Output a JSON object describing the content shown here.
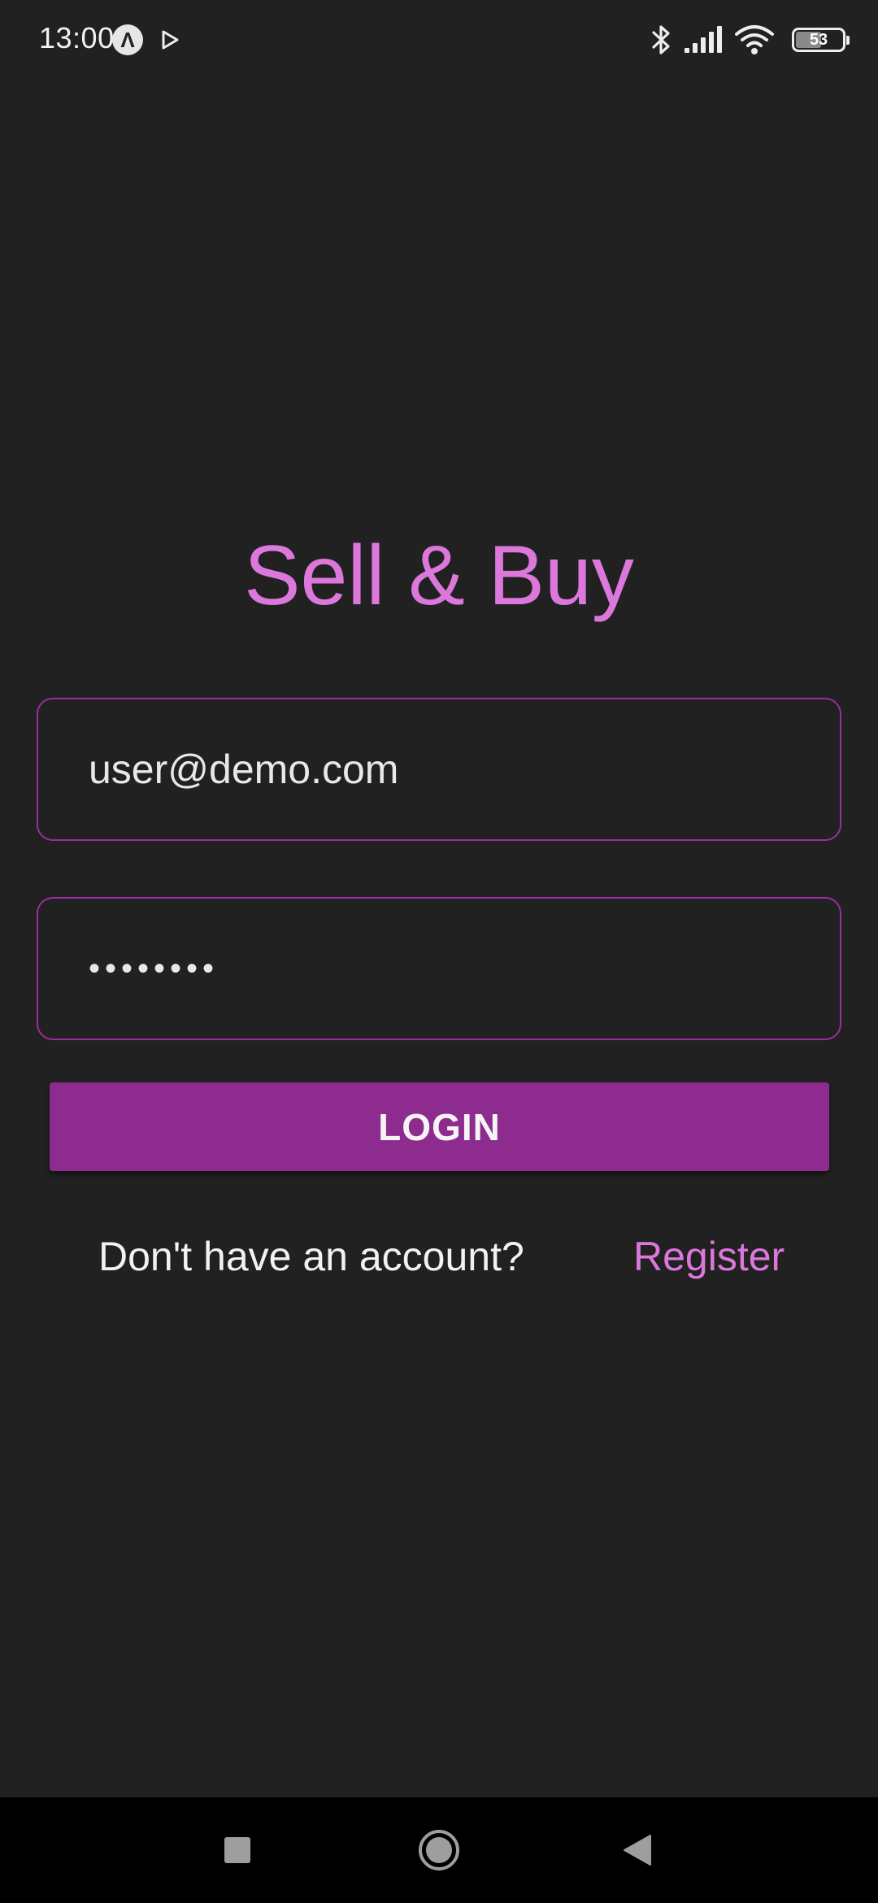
{
  "status_bar": {
    "time": "13:00",
    "battery_level": "53",
    "icons": [
      "app-notification-icon",
      "play-store-icon",
      "bluetooth-icon",
      "cellular-signal-icon",
      "wifi-icon",
      "battery-icon"
    ]
  },
  "app": {
    "title": "Sell & Buy"
  },
  "login_form": {
    "email_value": "user@demo.com",
    "password_value": "••••••••",
    "login_label": "LOGIN"
  },
  "register": {
    "prompt": "Don't have an account?",
    "link_label": "Register"
  },
  "colors": {
    "background": "#212121",
    "accent": "#DC77DC",
    "button": "#8E2B8F",
    "field_border": "#9C2BA3"
  },
  "nav_bar": {
    "buttons": [
      "recents-icon",
      "home-icon",
      "back-icon"
    ]
  }
}
